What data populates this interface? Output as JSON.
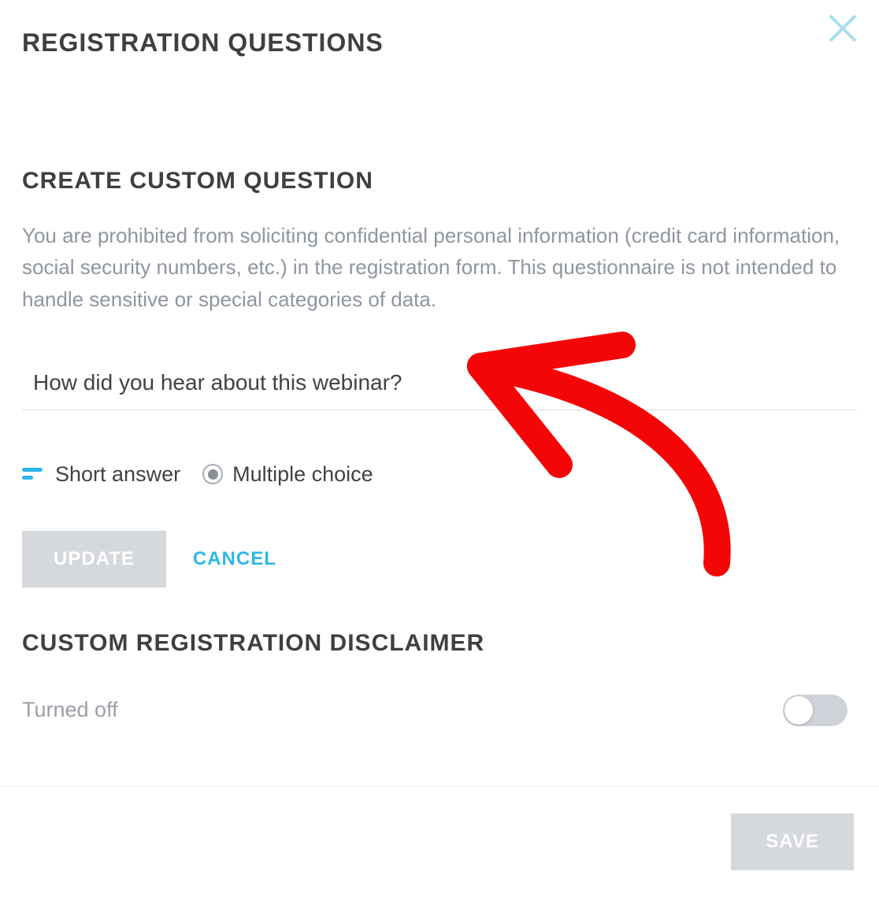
{
  "header": {
    "title": "REGISTRATION QUESTIONS"
  },
  "create": {
    "heading": "CREATE CUSTOM QUESTION",
    "description": "You are prohibited from soliciting confidential personal information (credit card information, social security numbers, etc.) in the registration form. This questionnaire is not intended to handle sensitive or special categories of data.",
    "question_value": "How did you hear about this webinar?",
    "types": {
      "short_label": "Short answer",
      "multiple_label": "Multiple choice"
    },
    "buttons": {
      "update": "UPDATE",
      "cancel": "CANCEL"
    }
  },
  "disclaimer": {
    "heading": "CUSTOM REGISTRATION DISCLAIMER",
    "status_label": "Turned off",
    "enabled": false
  },
  "footer": {
    "save": "SAVE"
  },
  "colors": {
    "accent": "#2fb7e7",
    "text": "#404040",
    "muted": "#9ba0a8",
    "disabled_btn": "#d5d8dc"
  }
}
